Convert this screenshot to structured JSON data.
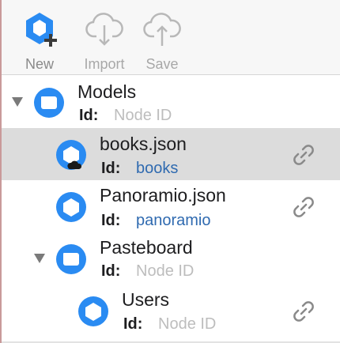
{
  "toolbar": {
    "new_label": "New",
    "import_label": "Import",
    "save_label": "Save"
  },
  "tree": {
    "id_label": "Id:",
    "nodes": [
      {
        "title": "Models",
        "id_value": "Node ID",
        "kind": "folder",
        "expanded": true,
        "has_link": false,
        "selected": false
      },
      {
        "title": "books.json",
        "id_value": "books",
        "kind": "model-cloud",
        "has_link": true,
        "selected": true
      },
      {
        "title": "Panoramio.json",
        "id_value": "panoramio",
        "kind": "model",
        "has_link": true,
        "selected": false
      },
      {
        "title": "Pasteboard",
        "id_value": "Node ID",
        "kind": "folder",
        "expanded": true,
        "has_link": false,
        "selected": false
      },
      {
        "title": "Users",
        "id_value": "Node ID",
        "kind": "model",
        "has_link": true,
        "selected": false
      }
    ]
  },
  "colors": {
    "accent": "#2a8bf2",
    "selected_row": "#dcdcdc",
    "id_value_filled": "#2f6ab0",
    "id_value_placeholder": "#bdbdbd"
  }
}
